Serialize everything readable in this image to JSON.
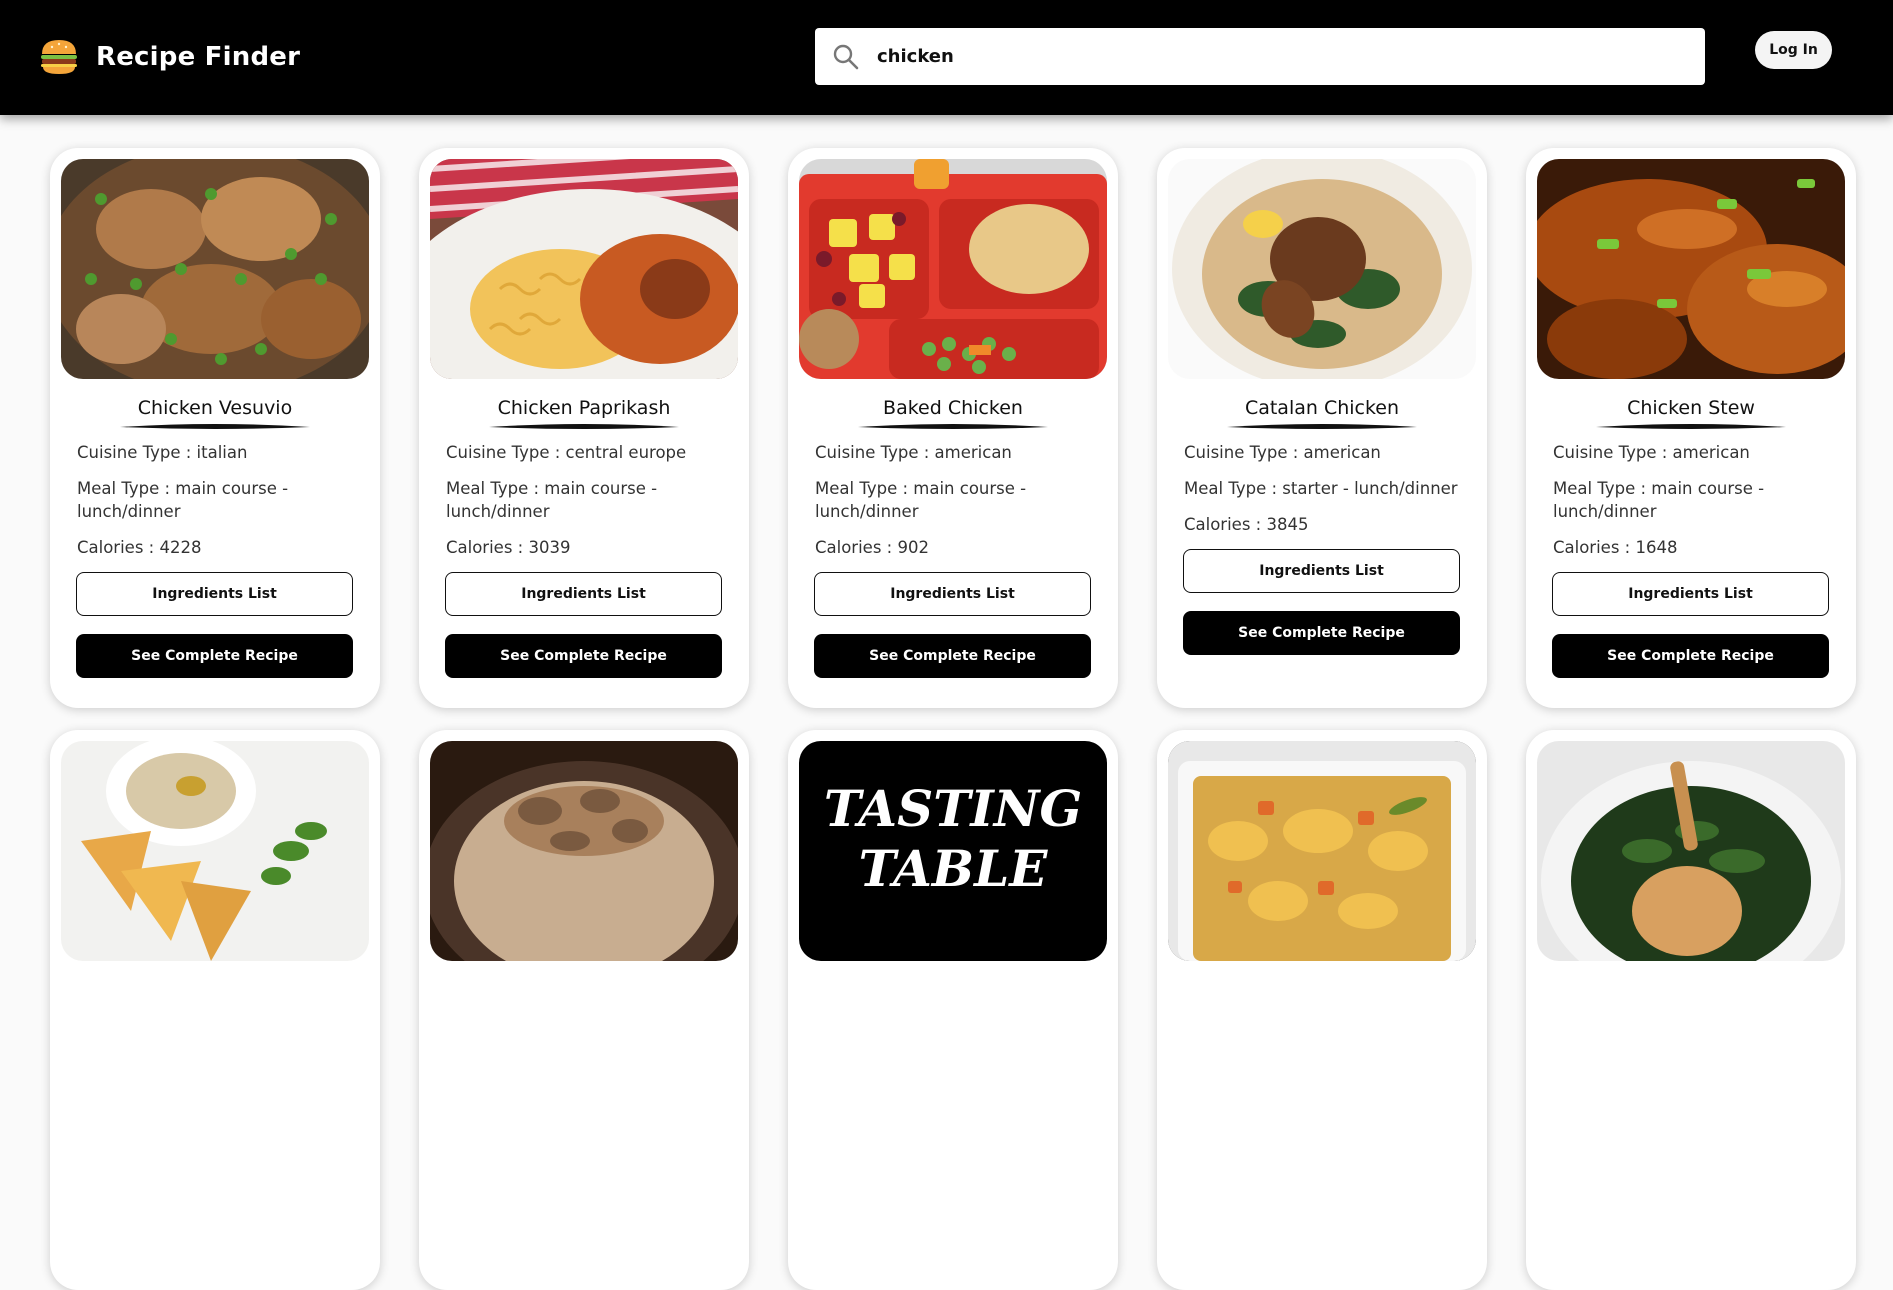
{
  "app": {
    "title": "Recipe Finder"
  },
  "search": {
    "value": "chicken",
    "icon": "search-icon"
  },
  "header": {
    "login_label": "Log In"
  },
  "labels": {
    "cuisine_prefix": "Cuisine Type : ",
    "meal_prefix": "Meal Type : ",
    "calories_prefix": "Calories : ",
    "ingredients_button": "Ingredients List",
    "recipe_button": "See Complete Recipe"
  },
  "recipes": [
    {
      "name": "Chicken Vesuvio",
      "cuisine": "italian",
      "meal": "main course - lunch/dinner",
      "calories": "4228"
    },
    {
      "name": "Chicken Paprikash",
      "cuisine": "central europe",
      "meal": "main course - lunch/dinner",
      "calories": "3039"
    },
    {
      "name": "Baked Chicken",
      "cuisine": "american",
      "meal": "main course - lunch/dinner",
      "calories": "902"
    },
    {
      "name": "Catalan Chicken",
      "cuisine": "american",
      "meal": "starter - lunch/dinner",
      "calories": "3845"
    },
    {
      "name": "Chicken Stew",
      "cuisine": "american",
      "meal": "main course - lunch/dinner",
      "calories": "1648"
    }
  ],
  "second_row_images": [
    {
      "subject": "hummus-pita"
    },
    {
      "subject": "mushroom-risotto"
    },
    {
      "subject": "tasting-table-logo",
      "logo_line1": "TASTING",
      "logo_line2": "TABLE"
    },
    {
      "subject": "chicken-casserole"
    },
    {
      "subject": "roast-chicken-greens"
    }
  ],
  "colors": {
    "header_bg": "#000000",
    "button_solid": "#000000",
    "page_bg": "#fafafa"
  }
}
